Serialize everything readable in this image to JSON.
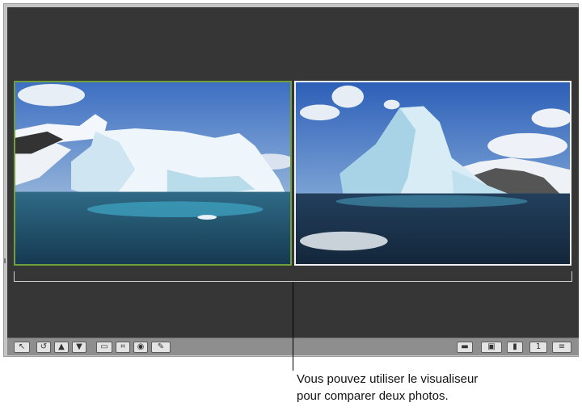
{
  "viewer": {
    "photos": [
      {
        "name": "iceberg-photo-1",
        "selected": true
      },
      {
        "name": "iceberg-photo-2",
        "selected": false
      }
    ]
  },
  "toolbar": {
    "left_tools": [
      {
        "icon": "arrow-select-icon",
        "glyph": "↖"
      },
      {
        "icon": "rotate-icon",
        "glyph": "↺"
      },
      {
        "icon": "lift-icon",
        "glyph": "▲"
      },
      {
        "icon": "stamp-icon",
        "glyph": "▼"
      },
      {
        "icon": "straighten-icon",
        "glyph": "▭"
      },
      {
        "icon": "crop-icon",
        "glyph": "⌗"
      },
      {
        "icon": "red-eye-icon",
        "glyph": "◉"
      },
      {
        "icon": "brush-icon",
        "glyph": "✎"
      }
    ],
    "right_tools": [
      {
        "icon": "folder-icon",
        "glyph": "▬"
      },
      {
        "icon": "viewer-mode-icon",
        "glyph": "▣"
      },
      {
        "icon": "flag-icon",
        "glyph": "▮"
      },
      {
        "icon": "single-view-icon",
        "glyph": "1"
      },
      {
        "icon": "list-view-icon",
        "glyph": "≡"
      }
    ]
  },
  "callout": {
    "line1": "Vous pouvez utiliser le visualiseur",
    "line2": "pour comparer deux photos."
  }
}
